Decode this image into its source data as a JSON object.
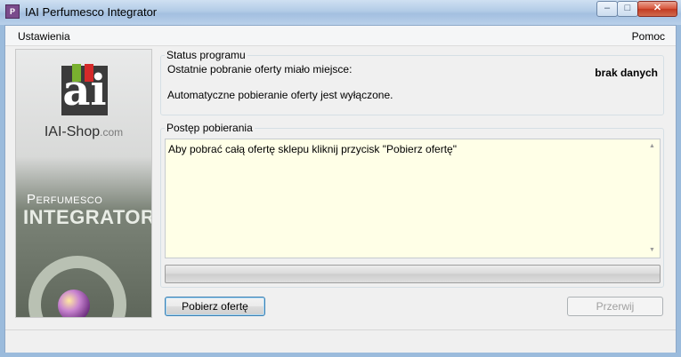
{
  "window": {
    "title": "IAI Perfumesco Integrator",
    "controls": {
      "minimize": "‒",
      "maximize": "□",
      "close": "✕"
    }
  },
  "menu": {
    "settings": "Ustawienia",
    "help": "Pomoc"
  },
  "sidebar": {
    "logo_text": "IAI-Shop",
    "logo_domain": ".com",
    "product_line1": "Perfumesco",
    "product_line2": "INTEGRATOR"
  },
  "status_group": {
    "legend": "Status programu",
    "last_download_label": "Ostatnie pobranie oferty miało miejsce:",
    "last_download_value": "brak danych",
    "auto_download_status": "Automatyczne pobieranie oferty jest wyłączone."
  },
  "progress_group": {
    "legend": "Postęp pobierania",
    "log_text": "Aby pobrać całą ofertę sklepu kliknij przycisk \"Pobierz ofertę\"",
    "progress": 0
  },
  "buttons": {
    "download": "Pobierz ofertę",
    "stop": "Przerwij"
  }
}
